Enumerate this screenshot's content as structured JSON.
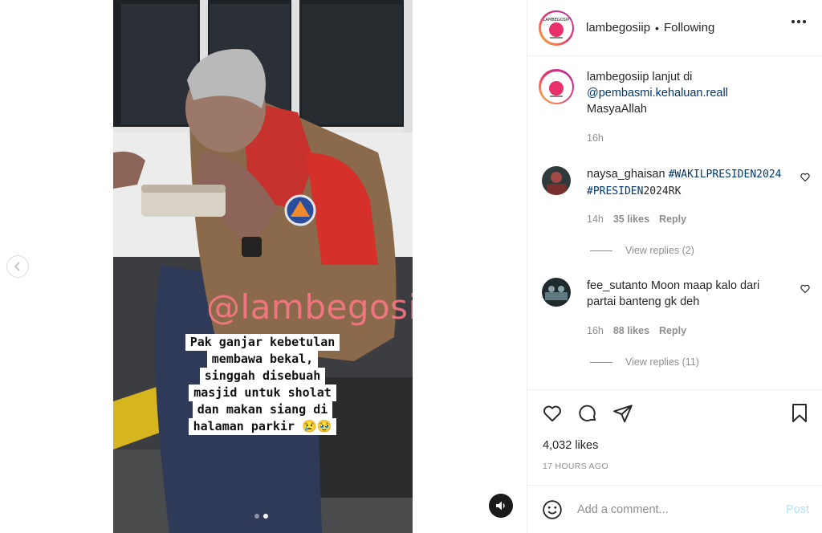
{
  "post": {
    "watermark": "@lambegosiip",
    "caption_lines": [
      "Pak ganjar kebetulan",
      "membawa bekal,",
      "singgah disebuah",
      "masjid untuk sholat",
      "dan makan siang di",
      "halaman parkir 😢🥹"
    ],
    "carousel": {
      "count": 2,
      "active_index": 1
    }
  },
  "header": {
    "username": "lambegosiip",
    "separator": "•",
    "follow_status": "Following",
    "avatar_logo_text": "LAMBEGOSIP"
  },
  "caption": {
    "username": "lambegosiip",
    "text": "lanjut di",
    "mention": "@pembasmi.kehaluan.reall",
    "body": "MasyaAllah",
    "time": "16h"
  },
  "comments": [
    {
      "username": "naysa_ghaisan",
      "tag1": "#WAKILPRESIDEN2024",
      "tag2_prefix": "#PRESIDEN",
      "tag2_suffix": "2024RK",
      "time": "14h",
      "likes": "35 likes",
      "reply": "Reply",
      "view_replies": "View replies (2)"
    },
    {
      "username": "fee_sutanto",
      "text": "Moon maap kalo dari partai banteng gk deh",
      "time": "16h",
      "likes": "88 likes",
      "reply": "Reply",
      "view_replies": "View replies (11)"
    }
  ],
  "engagement": {
    "likes": "4,032 likes",
    "time_ago": "17 HOURS AGO"
  },
  "add_comment": {
    "placeholder": "Add a comment...",
    "post_label": "Post"
  },
  "colors": {
    "link": "#00376b",
    "muted": "#8e8e8e",
    "post_disabled": "#b2dffc",
    "watermark": "#ff7887"
  }
}
